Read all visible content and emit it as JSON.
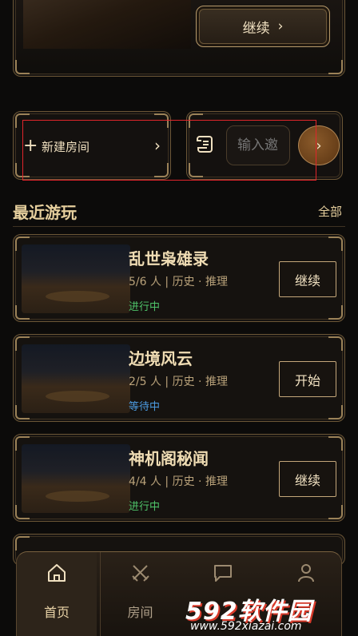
{
  "hero": {
    "continue_label": "继续",
    "chevron": "›"
  },
  "actions": {
    "create_room_label": "新建房间",
    "join_placeholder": "输入邀",
    "join_go": "›"
  },
  "recent": {
    "title": "最近游玩",
    "view_all": "全部",
    "items": [
      {
        "name": "乱世枭雄录",
        "meta": "5/6 人 | 历史 · 推理",
        "status": "进行中",
        "status_color": "#4fc46a",
        "action": "继续"
      },
      {
        "name": "边境风云",
        "meta": "2/5 人 | 历史 · 推理",
        "status": "等待中",
        "status_color": "#4c9be0",
        "action": "开始"
      },
      {
        "name": "神机阁秘闻",
        "meta": "4/4 人 | 历史 · 推理",
        "status": "进行中",
        "status_color": "#4fc46a",
        "action": "继续"
      }
    ]
  },
  "nav": {
    "home": "首页",
    "rooms": "房间"
  },
  "watermark": {
    "logo": "592软件园",
    "url": "www.592xiazai.com"
  },
  "colors": {
    "accent_gold": "#c4a77a",
    "status_active": "#4fc46a",
    "status_waiting": "#4c9be0",
    "annotation_red": "#e0252b"
  }
}
